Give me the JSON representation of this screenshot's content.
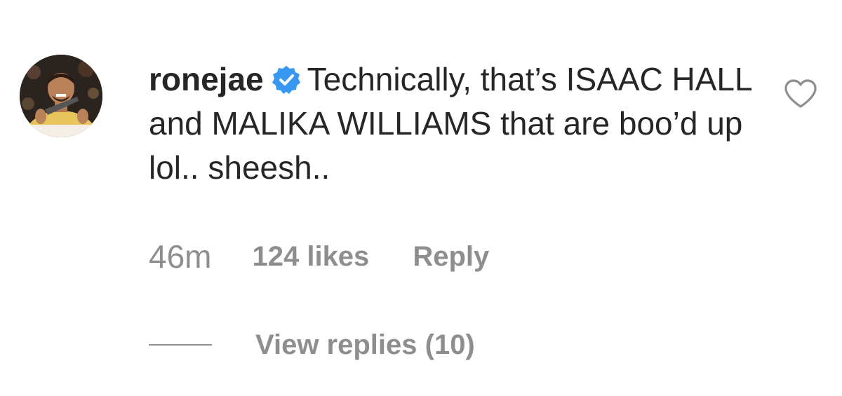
{
  "comment": {
    "avatar_icon": "user-avatar-photo",
    "username": "ronejae",
    "verified_icon": "verified-badge-icon",
    "verified_color": "#3897f0",
    "text": "Technically, that’s ISAAC HALL and MALIKA WILLIAMS that are boo’d up lol.. sheesh..",
    "like_icon": "heart-outline-icon",
    "time": "46m",
    "likes": "124 likes",
    "reply_label": "Reply",
    "view_replies_label": "View replies (10)"
  },
  "colors": {
    "primary_text": "#262626",
    "secondary_text": "#8e8e8e",
    "background": "#ffffff"
  }
}
